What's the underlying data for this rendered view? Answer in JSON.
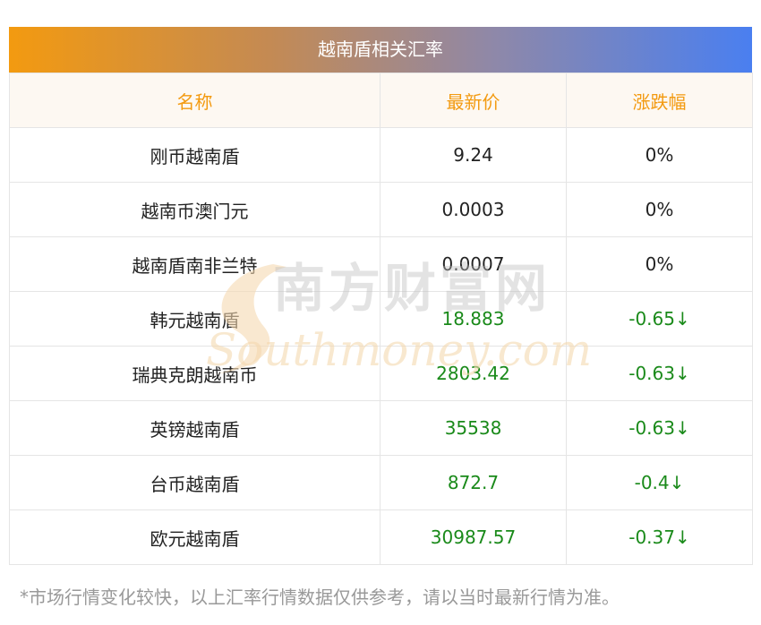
{
  "title": "越南盾相关汇率",
  "headers": {
    "name": "名称",
    "price": "最新价",
    "change": "涨跌幅"
  },
  "rows": [
    {
      "name": "刚币越南盾",
      "price": "9.24",
      "change": "0%",
      "trend": "flat"
    },
    {
      "name": "越南币澳门元",
      "price": "0.0003",
      "change": "0%",
      "trend": "flat"
    },
    {
      "name": "越南盾南非兰特",
      "price": "0.0007",
      "change": "0%",
      "trend": "flat"
    },
    {
      "name": "韩元越南盾",
      "price": "18.883",
      "change": "-0.65↓",
      "trend": "down"
    },
    {
      "name": "瑞典克朗越南币",
      "price": "2803.42",
      "change": "-0.63↓",
      "trend": "down"
    },
    {
      "name": "英镑越南盾",
      "price": "35538",
      "change": "-0.63↓",
      "trend": "down"
    },
    {
      "name": "台币越南盾",
      "price": "872.7",
      "change": "-0.4↓",
      "trend": "down"
    },
    {
      "name": "欧元越南盾",
      "price": "30987.57",
      "change": "-0.37↓",
      "trend": "down"
    }
  ],
  "watermark": {
    "brand": "南方财富网",
    "url": "Southmoney.com"
  },
  "footnote": "*市场行情变化较快，以上汇率行情数据仅供参考，请以当时最新行情为准。",
  "colors": {
    "header_text": "#f39a10",
    "gradient_start": "#f39a10",
    "gradient_end": "#4a7ff0",
    "down": "#1a8a1a"
  }
}
